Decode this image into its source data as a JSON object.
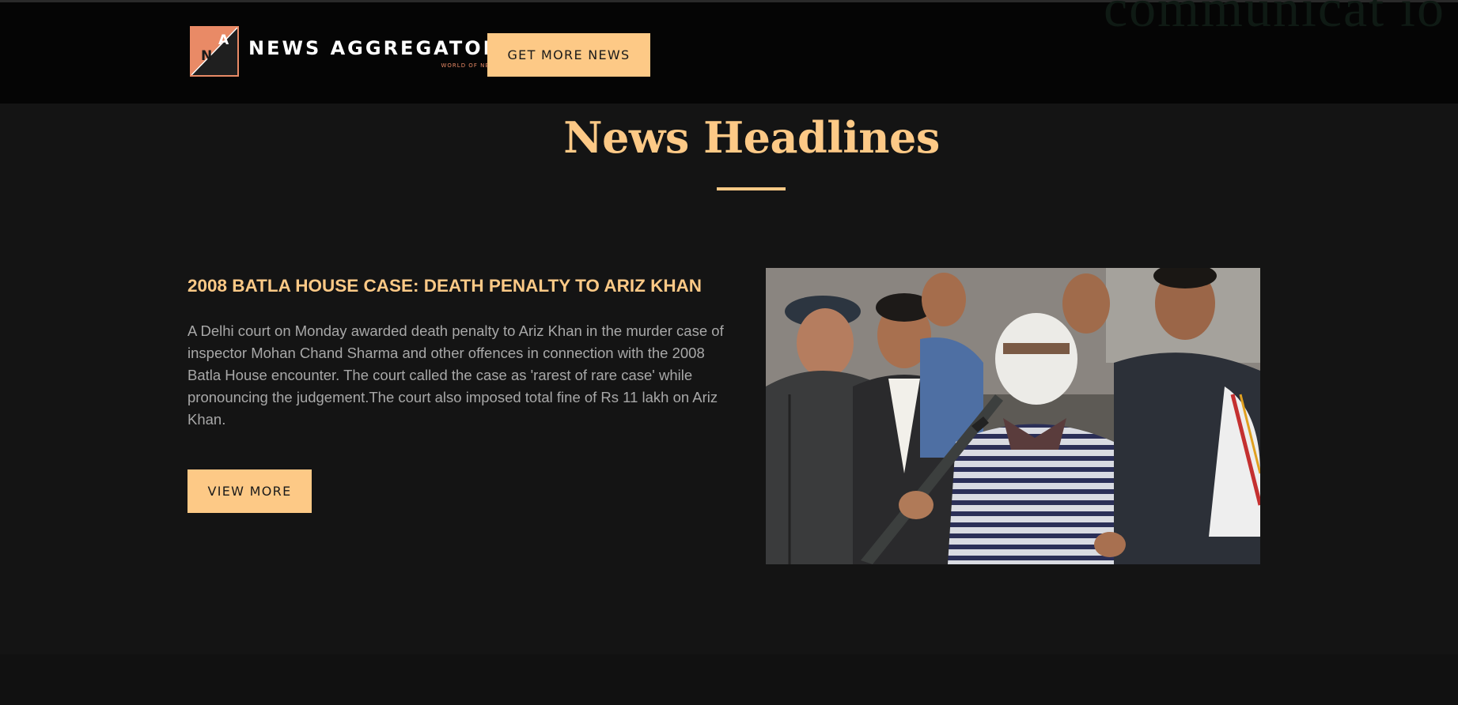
{
  "header": {
    "logo": {
      "mark_letters": [
        "A",
        "N"
      ],
      "name": "NEWS AGGREGATOR",
      "tagline": "WORLD OF NEWS"
    },
    "get_more_label": "GET MORE NEWS"
  },
  "section": {
    "title": "News Headlines"
  },
  "article": {
    "title": "2008 BATLA HOUSE CASE: DEATH PENALTY TO ARIZ KHAN",
    "body": "A Delhi court on Monday awarded death penalty to Ariz Khan in the murder case of inspector Mohan Chand Sharma and other offences in connection with the 2008 Batla House encounter. The court called the case as 'rarest of rare case' while pronouncing the judgement.The court also imposed total fine of Rs 11 lakh on Ariz Khan.",
    "view_more_label": "VIEW MORE"
  },
  "colors": {
    "accent": "#fdc986",
    "logo_orange": "#e98a66",
    "page_bg": "#141414",
    "header_bg": "#050505",
    "body_text": "#a8a8a8"
  }
}
